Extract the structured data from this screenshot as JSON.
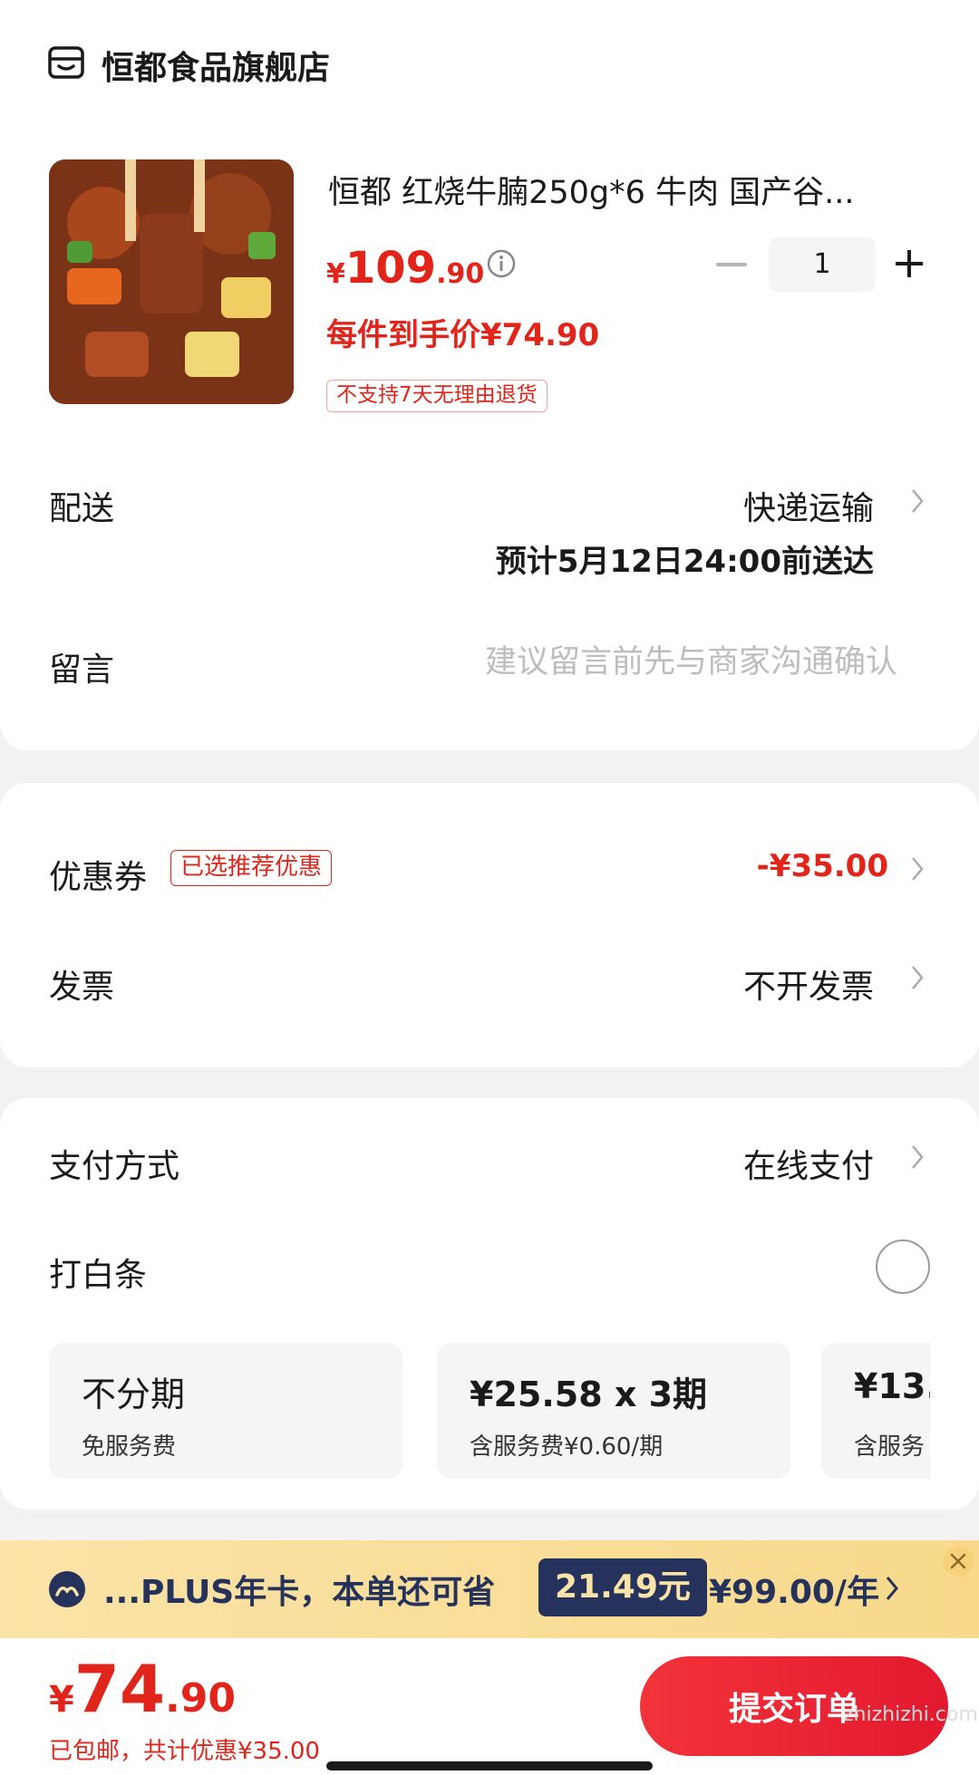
{
  "store": {
    "name": "恒都食品旗舰店",
    "icon": "store-icon"
  },
  "product": {
    "title": "恒都 红烧牛腩250g*6  牛肉  国产谷...",
    "price_symbol": "¥",
    "price_int": "109",
    "price_dec": ".90",
    "unit_price_text": "每件到手价¥74.90",
    "return_policy_tag": "不支持7天无理由退货",
    "quantity": "1"
  },
  "delivery": {
    "label": "配送",
    "method": "快递运输",
    "estimate": "预计5月12日24:00前送达"
  },
  "message": {
    "label": "留言",
    "placeholder": "建议留言前先与商家沟通确认"
  },
  "coupon": {
    "label": "优惠券",
    "tag": "已选推荐优惠",
    "value": "-¥35.00"
  },
  "invoice": {
    "label": "发票",
    "value": "不开发票"
  },
  "payment": {
    "label": "支付方式",
    "value": "在线支付"
  },
  "baitiao": {
    "label": "打白条",
    "selected": false,
    "plans": [
      {
        "main": "不分期",
        "sub": "免服务费"
      },
      {
        "main": "¥25.58 x 3期",
        "sub": "含服务费¥0.60/期"
      },
      {
        "main": "¥13.",
        "sub": "含服务"
      }
    ]
  },
  "plus_banner": {
    "text": "...PLUS年卡，本单还可省",
    "save_amount": "21.49元",
    "annual_price": "¥99.00/年"
  },
  "footer": {
    "total_symbol": "¥",
    "total_int": "74",
    "total_dec": ".90",
    "note": "已包邮，共计优惠¥35.00",
    "submit_label": "提交订单",
    "watermark": "zhizhizhi.com"
  },
  "colors": {
    "accent": "#e1251b",
    "plus_navy": "#25335c",
    "plus_gold": "#f8d98c"
  }
}
